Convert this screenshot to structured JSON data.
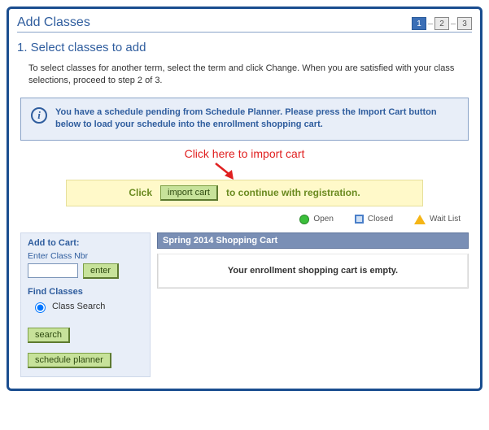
{
  "header": {
    "title": "Add Classes",
    "steps": [
      "1",
      "2",
      "3"
    ],
    "active_step": 0
  },
  "section": {
    "title": "1.  Select classes to add",
    "instructions": "To select classes for another term, select the term and click Change.  When you are satisfied with your class selections, proceed to step 2 of 3."
  },
  "info": {
    "message": "You have a schedule pending from Schedule Planner.  Please press the Import Cart button below to load your schedule into the enrollment shopping cart."
  },
  "callout": {
    "text": "Click here to import cart"
  },
  "import_bar": {
    "click_label": "Click",
    "button_label": "import cart",
    "continue_label": "to continue with registration."
  },
  "legend": {
    "open": "Open",
    "closed": "Closed",
    "waitlist": "Wait List"
  },
  "sidebar": {
    "add_to_cart_label": "Add to Cart:",
    "enter_nbr_label": "Enter Class Nbr",
    "class_nbr_value": "",
    "enter_button": "enter",
    "find_classes_label": "Find Classes",
    "class_search_label": "Class Search",
    "search_button": "search",
    "planner_button": "schedule planner"
  },
  "cart": {
    "header": "Spring 2014 Shopping Cart",
    "empty_message": "Your enrollment shopping cart is empty."
  }
}
